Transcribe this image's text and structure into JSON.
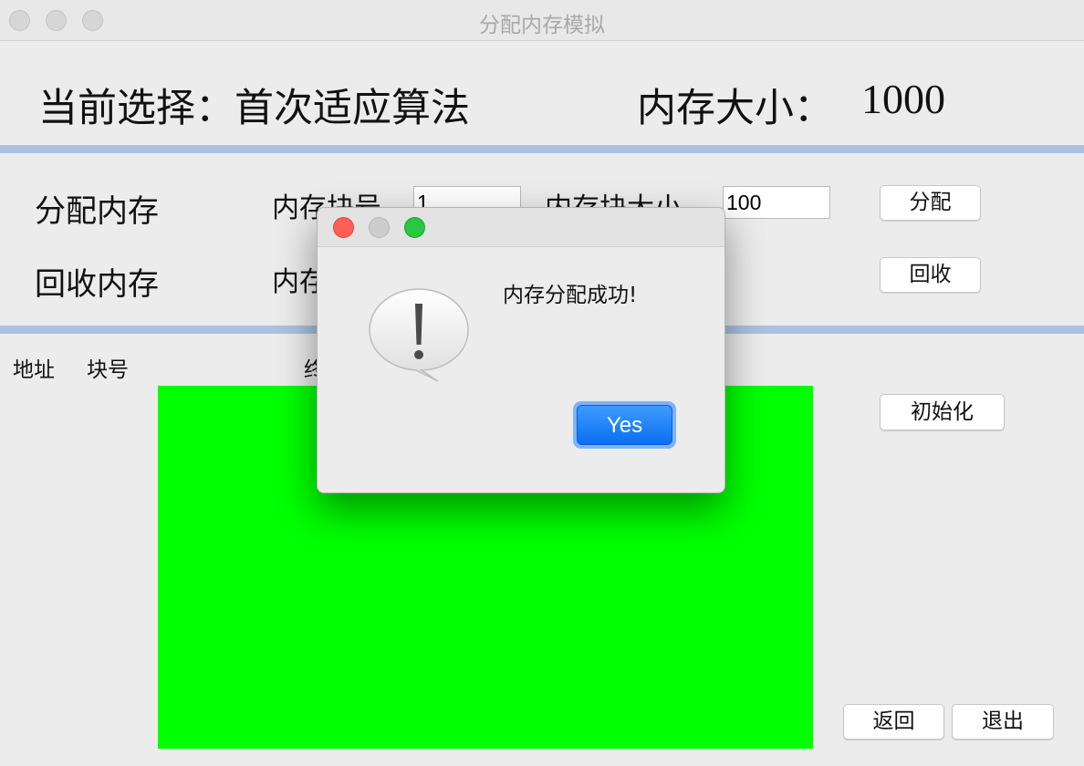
{
  "window": {
    "title": "分配内存模拟"
  },
  "header": {
    "selection_text": "当前选择：首次适应算法",
    "memory_label": "内存大小：",
    "memory_value": "1000"
  },
  "allocate": {
    "row_label": "分配内存",
    "block_id_label": "内存块号",
    "block_id_value": "1",
    "block_size_label": "内存块大小",
    "block_size_value": "100",
    "button": "分配"
  },
  "recycle": {
    "row_label": "回收内存",
    "block_id_label": "内存块号",
    "button": "回收"
  },
  "table": {
    "headers": [
      "地址",
      "块号",
      "终"
    ]
  },
  "sidebar": {
    "init_button": "初始化"
  },
  "footer": {
    "back_button": "返回",
    "exit_button": "退出"
  },
  "dialog": {
    "message": "内存分配成功!",
    "yes_button": "Yes"
  },
  "colors": {
    "memory_block": "#00ff00",
    "separator": "#a9c3df",
    "yes_button": "#0a6ff0",
    "close_light": "#fe5f57",
    "minimize_light": "#cdcdcd",
    "zoom_light": "#28c840"
  }
}
